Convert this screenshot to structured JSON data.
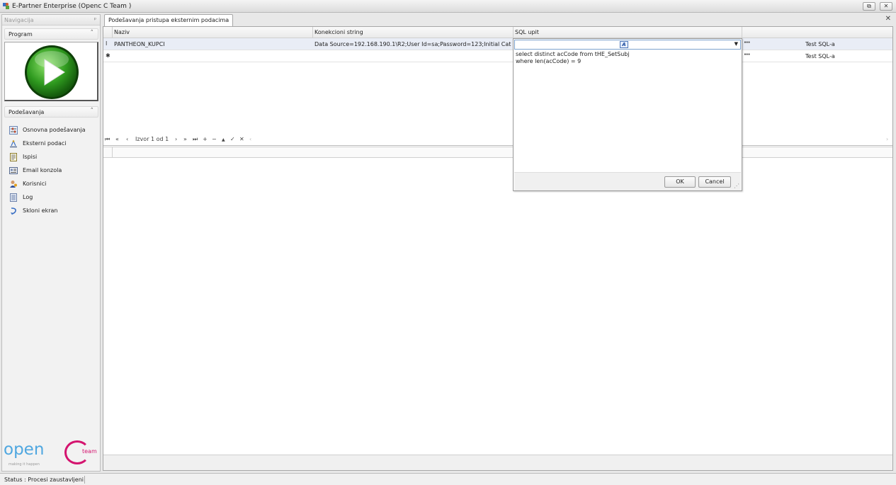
{
  "window": {
    "title": "E-Partner Enterprise (Openc C Team )",
    "restore_glyph": "⧉",
    "close_glyph": "✕"
  },
  "navigation": {
    "header": "Navigacija",
    "pin_glyph": "ᵖ",
    "groups": [
      {
        "label": "Program",
        "chevron": "˄"
      },
      {
        "label": "Podešavanja",
        "chevron": "˄"
      }
    ],
    "items": [
      {
        "label": "Osnovna podešavanja",
        "icon": "settings-sliders-icon"
      },
      {
        "label": "Eksterni podaci",
        "icon": "external-data-icon"
      },
      {
        "label": "Ispisi",
        "icon": "print-report-icon"
      },
      {
        "label": "Email konzola",
        "icon": "email-console-icon"
      },
      {
        "label": "Korisnici",
        "icon": "users-icon"
      },
      {
        "label": "Log",
        "icon": "log-document-icon"
      },
      {
        "label": "Skloni ekran",
        "icon": "hide-screen-icon"
      }
    ]
  },
  "logo": {
    "word": "open",
    "team": "team",
    "slogan": "making it happen"
  },
  "tab": {
    "label": "Podešavanja pristupa eksternim podacima",
    "close_glyph": "✕"
  },
  "grid": {
    "columns": [
      "Naziv",
      "Konekcioni string",
      "SQL upit"
    ],
    "rows": [
      {
        "indicator": "I",
        "naziv": "PANTHEON_KUPCI",
        "konekcioni_string": "Data Source=192.168.190.1\\R2;User Id=sa;Password=123;Initial Cat...",
        "dots": "···",
        "action": "Test SQL-a"
      },
      {
        "indicator": "✱",
        "naziv": "",
        "konekcioni_string": "",
        "dots": "···",
        "action": "Test SQL-a"
      }
    ],
    "navigator": {
      "first": "⏮",
      "prev_page": "«",
      "prev": "‹",
      "record_text": "Izvor 1 od 1",
      "next": "›",
      "next_page": "»",
      "last": "⏭",
      "add": "+",
      "remove": "−",
      "up": "▲",
      "check": "✓",
      "cancel": "✕",
      "scroll_left": "‹",
      "scroll_right": "›"
    }
  },
  "sql_editor": {
    "text": "select distinct acCode from tHE_SetSubj\nwhere len(acCode) = 9",
    "format_icon_glyph": "A",
    "dropdown_glyph": "▼",
    "ok_label": "OK",
    "cancel_label": "Cancel",
    "grip_glyph": "⋰"
  },
  "status": {
    "text": "Status : Procesi zaustavljeni"
  }
}
